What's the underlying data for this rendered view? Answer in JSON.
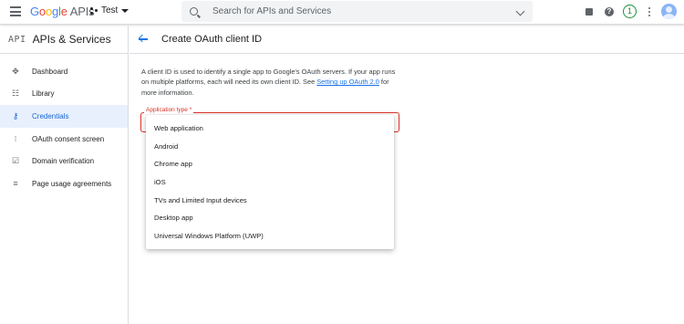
{
  "topbar": {
    "logo_google": [
      "G",
      "o",
      "o",
      "g",
      "l",
      "e"
    ],
    "logo_apis": "APIs",
    "project_name": "Test",
    "search_placeholder": "Search for APIs and Services",
    "notification_count": "1",
    "help_glyph": "?"
  },
  "sidebar": {
    "api_badge": "API",
    "title": "APIs & Services",
    "items": [
      {
        "label": "Dashboard",
        "icon": "dashboard-icon",
        "glyph": "✥",
        "active": false
      },
      {
        "label": "Library",
        "icon": "library-icon",
        "glyph": "☷",
        "active": false
      },
      {
        "label": "Credentials",
        "icon": "key-icon",
        "glyph": "⚷",
        "active": true
      },
      {
        "label": "OAuth consent screen",
        "icon": "consent-icon",
        "glyph": "⁝",
        "active": false
      },
      {
        "label": "Domain verification",
        "icon": "verify-icon",
        "glyph": "☑",
        "active": false
      },
      {
        "label": "Page usage agreements",
        "icon": "agreement-icon",
        "glyph": "≡",
        "active": false
      }
    ]
  },
  "main": {
    "title": "Create OAuth client ID",
    "intro_before": "A client ID is used to identify a single app to Google's OAuth servers. If your app runs on multiple platforms, each will need its own client ID. See ",
    "intro_link": "Setting up OAuth 2.0",
    "intro_after": " for more information.",
    "field_label": "Application type *",
    "options": [
      "Web application",
      "Android",
      "Chrome app",
      "iOS",
      "TVs and Limited Input devices",
      "Desktop app",
      "Universal Windows Platform (UWP)"
    ]
  },
  "colors": {
    "accent": "#1a73e8",
    "error": "#d93025",
    "active_bg": "#e8f0fe"
  }
}
